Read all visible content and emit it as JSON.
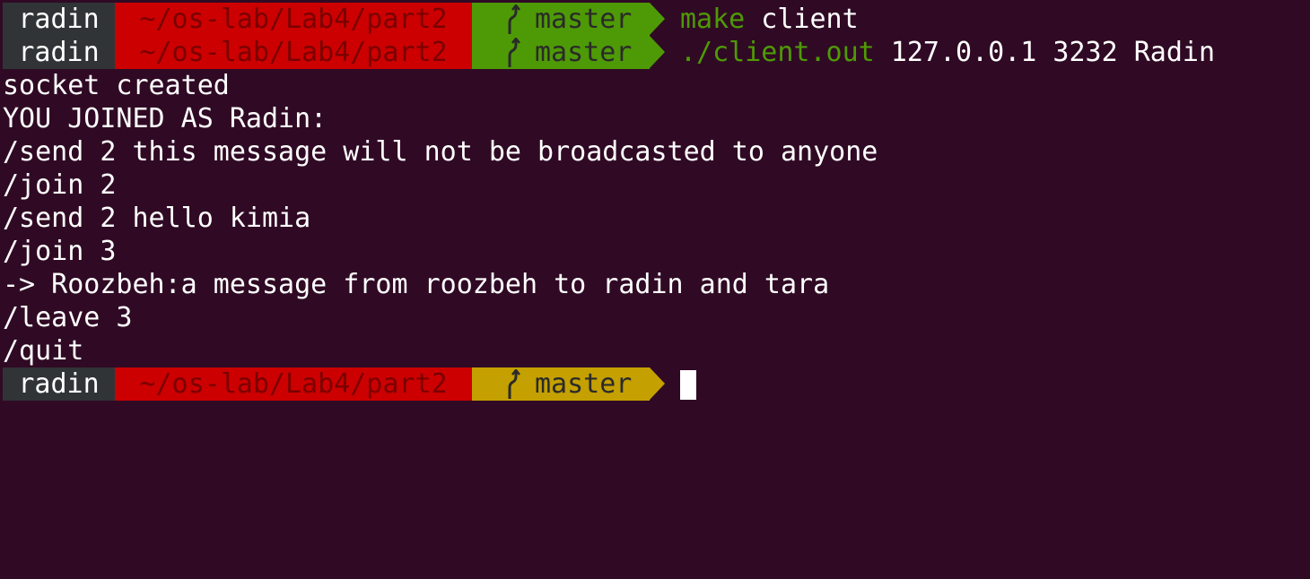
{
  "colors": {
    "background": "#300a24",
    "user_segment": "#303437",
    "path_segment": "#cc0000",
    "git_clean": "#4e9a06",
    "git_dirty": "#c4a000",
    "command_name": "#4e9a06",
    "text": "#ffffff"
  },
  "prompts": [
    {
      "user": "radin",
      "path": "~/os-lab/Lab4/part2",
      "branch_icon": "git-branch-icon",
      "branch": "master",
      "git_state": "green",
      "command": "make",
      "args": " client"
    },
    {
      "user": "radin",
      "path": "~/os-lab/Lab4/part2",
      "branch_icon": "git-branch-icon",
      "branch": "master",
      "git_state": "green",
      "command": "./client.out",
      "args": " 127.0.0.1 3232 Radin"
    }
  ],
  "output": [
    "socket created",
    "YOU JOINED AS Radin:",
    "/send 2 this message will not be broadcasted to anyone",
    "/join 2",
    "/send 2 hello kimia",
    "/join 3",
    "-> Roozbeh:a message from roozbeh to radin and tara",
    "/leave 3",
    "/quit"
  ],
  "final_prompt": {
    "user": "radin",
    "path": "~/os-lab/Lab4/part2",
    "branch_icon": "git-branch-icon",
    "branch": "master",
    "git_state": "yellow"
  }
}
